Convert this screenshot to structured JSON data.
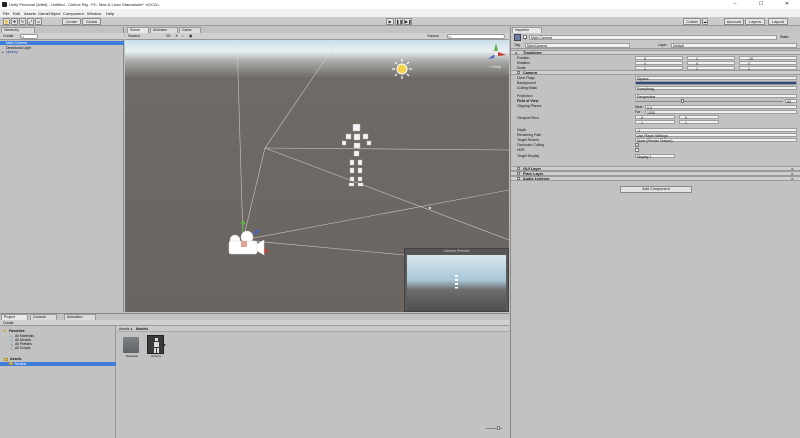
{
  "window": {
    "title": "Unity Personal (64bit) - Untitled - Cinhux Rig - PC, Mac & Linux Standalone* <DX11>",
    "minimize": "–",
    "maximize": "☐",
    "close": "✕"
  },
  "menu": [
    "File",
    "Edit",
    "Assets",
    "GameObject",
    "Component",
    "Window",
    "Help"
  ],
  "toolbar": {
    "pivot": "Center",
    "space": "Global",
    "collab": "Collab",
    "account": "Account",
    "layers": "Layers",
    "layout": "Layout"
  },
  "hierarchy": {
    "tab": "Hierarchy",
    "create": "Create",
    "search_placeholder": "All",
    "items": [
      "Main Camera",
      "Directional Light",
      "cinhuxy"
    ]
  },
  "scene": {
    "tabs": [
      "Scene",
      "Animator",
      "Game"
    ],
    "shading": "Shaded",
    "mode2d": "2D",
    "gizmos": "Gizmos",
    "search_placeholder": "All",
    "persp": "< Persp",
    "camera_preview": "Camera Preview"
  },
  "inspector": {
    "tab": "Inspector",
    "object_name": "Main Camera",
    "static": "Static",
    "tag_label": "Tag",
    "tag": "MainCamera",
    "layer_label": "Layer",
    "layer": "Default",
    "transform": {
      "title": "Transform",
      "rows": [
        {
          "label": "Position",
          "x": "0",
          "y": "1",
          "z": "-10"
        },
        {
          "label": "Rotation",
          "x": "0",
          "y": "0",
          "z": "0"
        },
        {
          "label": "Scale",
          "x": "1",
          "y": "1",
          "z": "1"
        }
      ]
    },
    "camera": {
      "title": "Camera",
      "rows": [
        {
          "label": "Clear Flags",
          "value": "Skybox"
        },
        {
          "label": "Background",
          "value": ""
        },
        {
          "label": "Culling Mask",
          "value": "Everything"
        },
        {
          "label": "Projection",
          "value": "Perspective"
        },
        {
          "label": "Field of View",
          "value": "60"
        },
        {
          "label": "Clipping Planes",
          "value": ""
        },
        {
          "label": "Near",
          "value": "0.3"
        },
        {
          "label": "Far",
          "value": "1000"
        },
        {
          "label": "Viewport Rect",
          "value": ""
        },
        {
          "label": "Depth",
          "value": "-1"
        },
        {
          "label": "Rendering Path",
          "value": "Use Player Settings"
        },
        {
          "label": "Target Texture",
          "value": "None (Render Texture)"
        },
        {
          "label": "Occlusion Culling",
          "value": ""
        },
        {
          "label": "HDR",
          "value": ""
        },
        {
          "label": "Target Display",
          "value": "Display 1"
        }
      ],
      "viewport": [
        {
          "x": "0",
          "y": "0"
        },
        {
          "w": "1",
          "h": "1"
        }
      ]
    },
    "components": [
      "GUI Layer",
      "Flare Layer",
      "Audio Listener"
    ],
    "add_component": "Add Component"
  },
  "project": {
    "tabs": [
      "Project",
      "Console",
      "Animation"
    ],
    "create": "Create",
    "favorites": "Favorites",
    "favorite_items": [
      "All Materials",
      "All Models",
      "All Prefabs",
      "All Scripts"
    ],
    "assets": "Assets",
    "asset_items": [
      "Models"
    ],
    "breadcrumb": [
      "Assets",
      "Models"
    ],
    "files": [
      {
        "name": "Materials"
      },
      {
        "name": "cinhuxy"
      }
    ]
  },
  "colors": {
    "accent": "#3e7ddc",
    "viewport_ground": "#6b6561",
    "viewport_sky": "#c9dfea"
  }
}
